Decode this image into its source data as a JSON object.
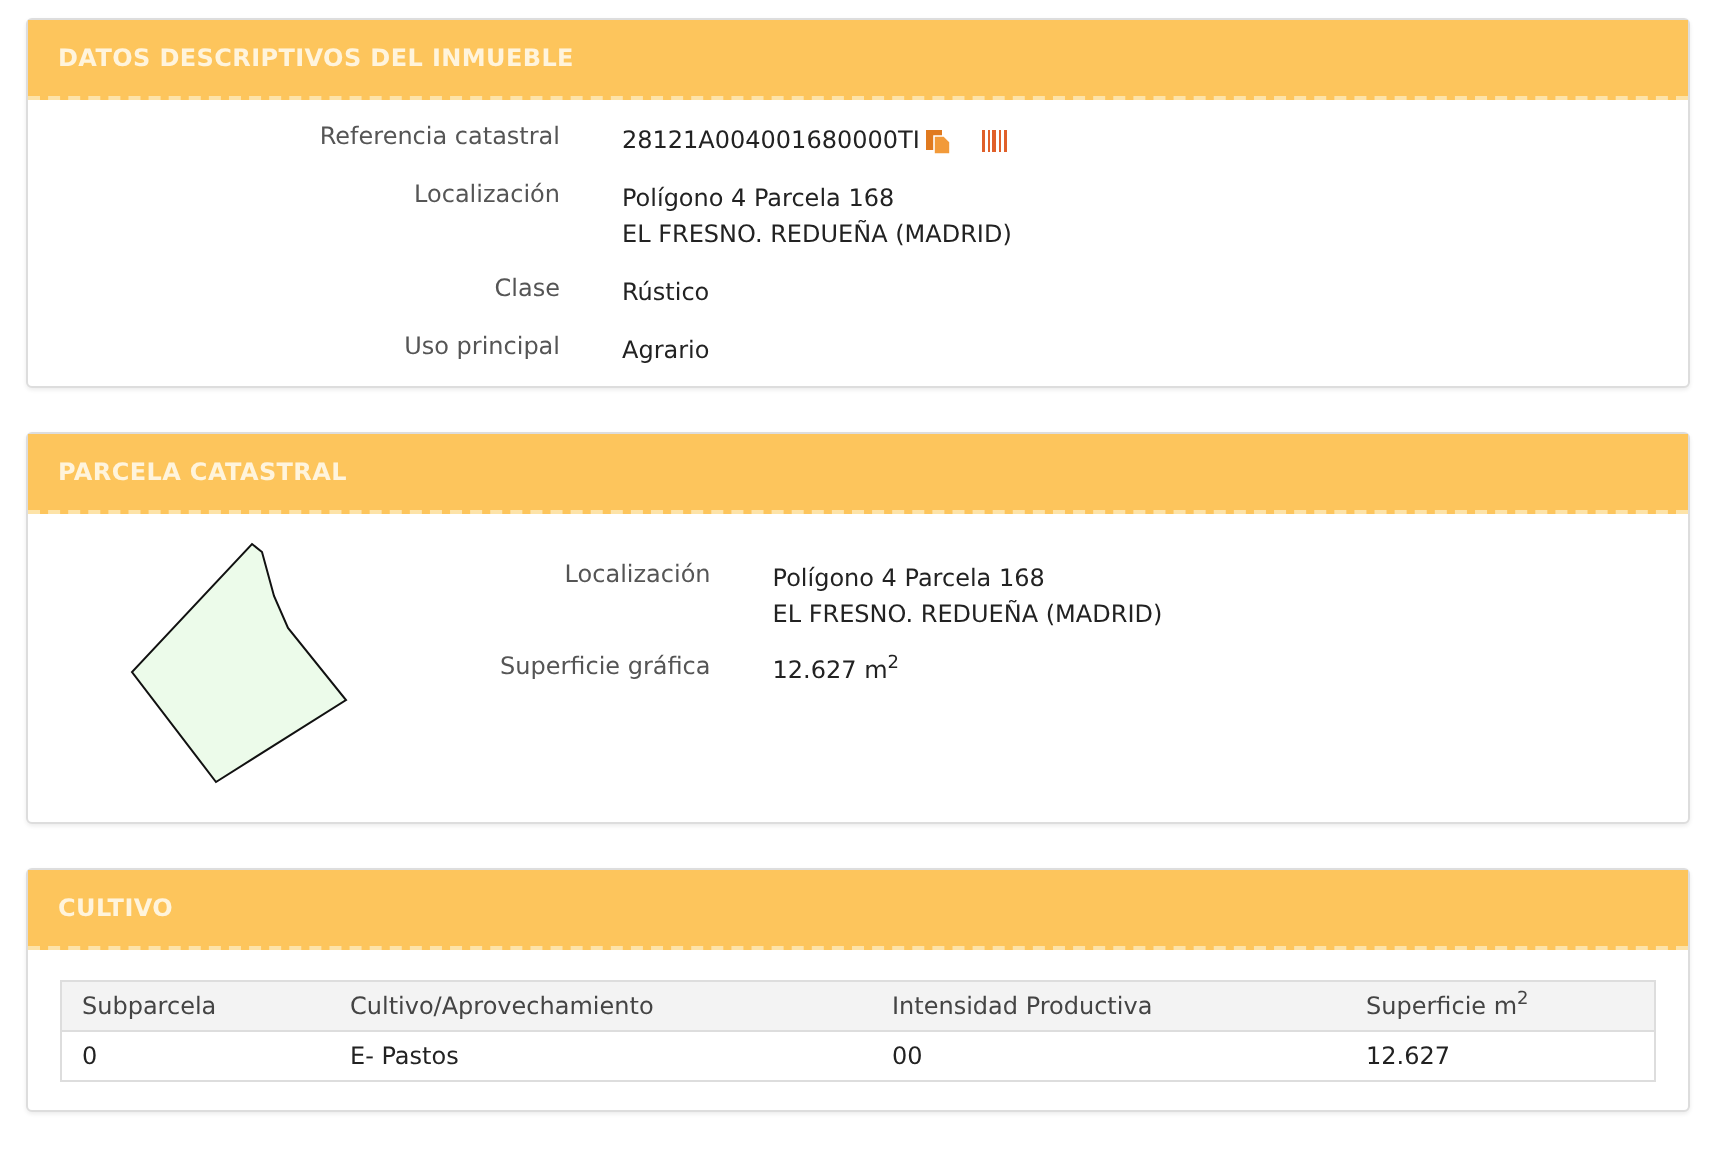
{
  "inmueble": {
    "title": "DATOS DESCRIPTIVOS DEL INMUEBLE",
    "fields": [
      {
        "label": "Referencia catastral",
        "lines": [
          "28121A004001680000TI"
        ],
        "kind": "reference"
      },
      {
        "label": "Localización",
        "lines": [
          "Polígono 4 Parcela 168",
          "EL FRESNO. REDUEÑA (MADRID)"
        ],
        "kind": "text"
      },
      {
        "label": "Clase",
        "lines": [
          "Rústico"
        ],
        "kind": "text"
      },
      {
        "label": "Uso principal",
        "lines": [
          "Agrario"
        ],
        "kind": "text"
      }
    ]
  },
  "parcela": {
    "title": "PARCELA CATASTRAL",
    "fields": [
      {
        "label": "Localización",
        "lines": [
          "Polígono 4 Parcela 168",
          "EL FRESNO. REDUEÑA (MADRID)"
        ],
        "kind": "text"
      },
      {
        "label": "Superficie gráfica",
        "lines": [
          "12.627 m$^{2}$"
        ],
        "kind": "text"
      }
    ]
  },
  "cultivo": {
    "title": "CULTIVO",
    "table": {
      "columns": [
        "Subparcela",
        "Cultivo/Aprovechamiento",
        "Intensidad Productiva",
        "Superficie m$^{2}$"
      ],
      "rows": [
        [
          "0",
          "E- Pastos",
          "00",
          "12.627"
        ]
      ]
    }
  }
}
